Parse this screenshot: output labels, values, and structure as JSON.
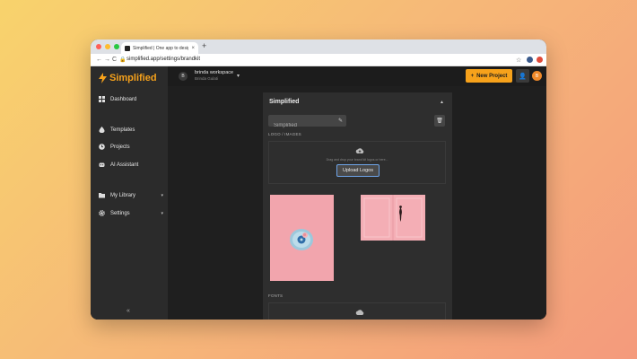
{
  "browser": {
    "tab_title": "Simplified | One app to design...",
    "tab_close": "×",
    "new_tab": "+",
    "url": "simplified.app/settings/brandkit",
    "back": "←",
    "forward": "→",
    "reload": "C",
    "lock": "🔒",
    "star": "☆"
  },
  "sidebar": {
    "logo_text": "Simplified",
    "items": [
      {
        "label": "Dashboard",
        "icon": "grid-icon"
      },
      {
        "label": "Templates",
        "icon": "drop-icon"
      },
      {
        "label": "Projects",
        "icon": "clock-icon"
      },
      {
        "label": "AI Assistant",
        "icon": "robot-icon"
      },
      {
        "label": "My Library",
        "icon": "folder-icon",
        "caret": "▾"
      },
      {
        "label": "Settings",
        "icon": "gear-icon",
        "caret": "▾"
      }
    ],
    "collapse": "«"
  },
  "topbar": {
    "workspace_initial": "B",
    "workspace_name": "brinda workspace",
    "workspace_sub": "Brinda Gulati",
    "workspace_caret": "▾",
    "new_project_label": "New Project",
    "new_project_plus": "+",
    "invite_icon": "👤",
    "user_initial": "B"
  },
  "panel": {
    "title": "Simplified",
    "caret": "▲",
    "name_value": "Simplified",
    "pencil": "✎",
    "trash": "🗑",
    "logo_section": "LOGO / IMAGES",
    "drop_text": "Drag and drop your brand kit logos or here...",
    "upload_label": "Upload Logos",
    "fonts_section": "FONTS"
  },
  "help": "?",
  "colors": {
    "accent": "#f7a21b",
    "background": "#1f1f1f",
    "panel": "#2e2e2e"
  }
}
